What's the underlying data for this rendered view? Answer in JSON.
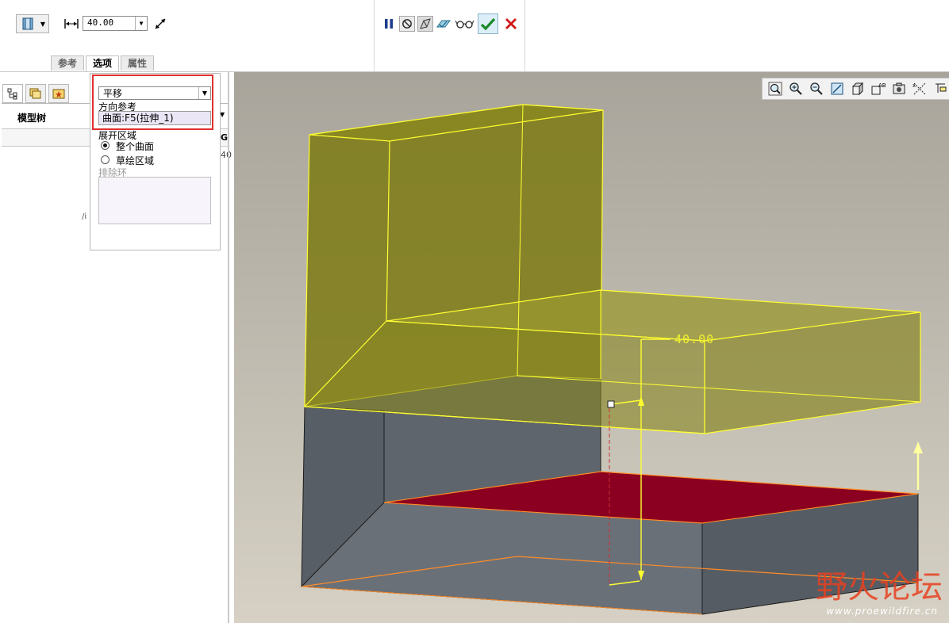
{
  "dashboard": {
    "depth_value": "40.00",
    "tabs": [
      {
        "label": "参考",
        "active": false
      },
      {
        "label": "选项",
        "active": true
      },
      {
        "label": "属性",
        "active": false
      }
    ]
  },
  "left_pane": {
    "model_tree_label": "模型树",
    "column_header_fragment": "G",
    "column_value_fragment": "40",
    "row_fragment": "/i"
  },
  "options_panel": {
    "move_type": "平移",
    "direction_ref_label": "方向参考",
    "direction_ref_value": "曲面:F5(拉伸_1)",
    "expand_area_label": "展开区域",
    "radio_options": [
      {
        "label": "整个曲面",
        "checked": true
      },
      {
        "label": "草绘区域",
        "checked": false
      }
    ],
    "exclude_loops_label": "排除环"
  },
  "viewport": {
    "dimension_label": "40.00"
  },
  "watermark": {
    "brand_text": "野火论坛",
    "url": "www.proewildfire.cn"
  },
  "colors": {
    "highlight": "#e03030",
    "surface_yellow": "#8c8a10",
    "selected_surface": "#8b0020",
    "solid_gray": "#5a5f66"
  }
}
